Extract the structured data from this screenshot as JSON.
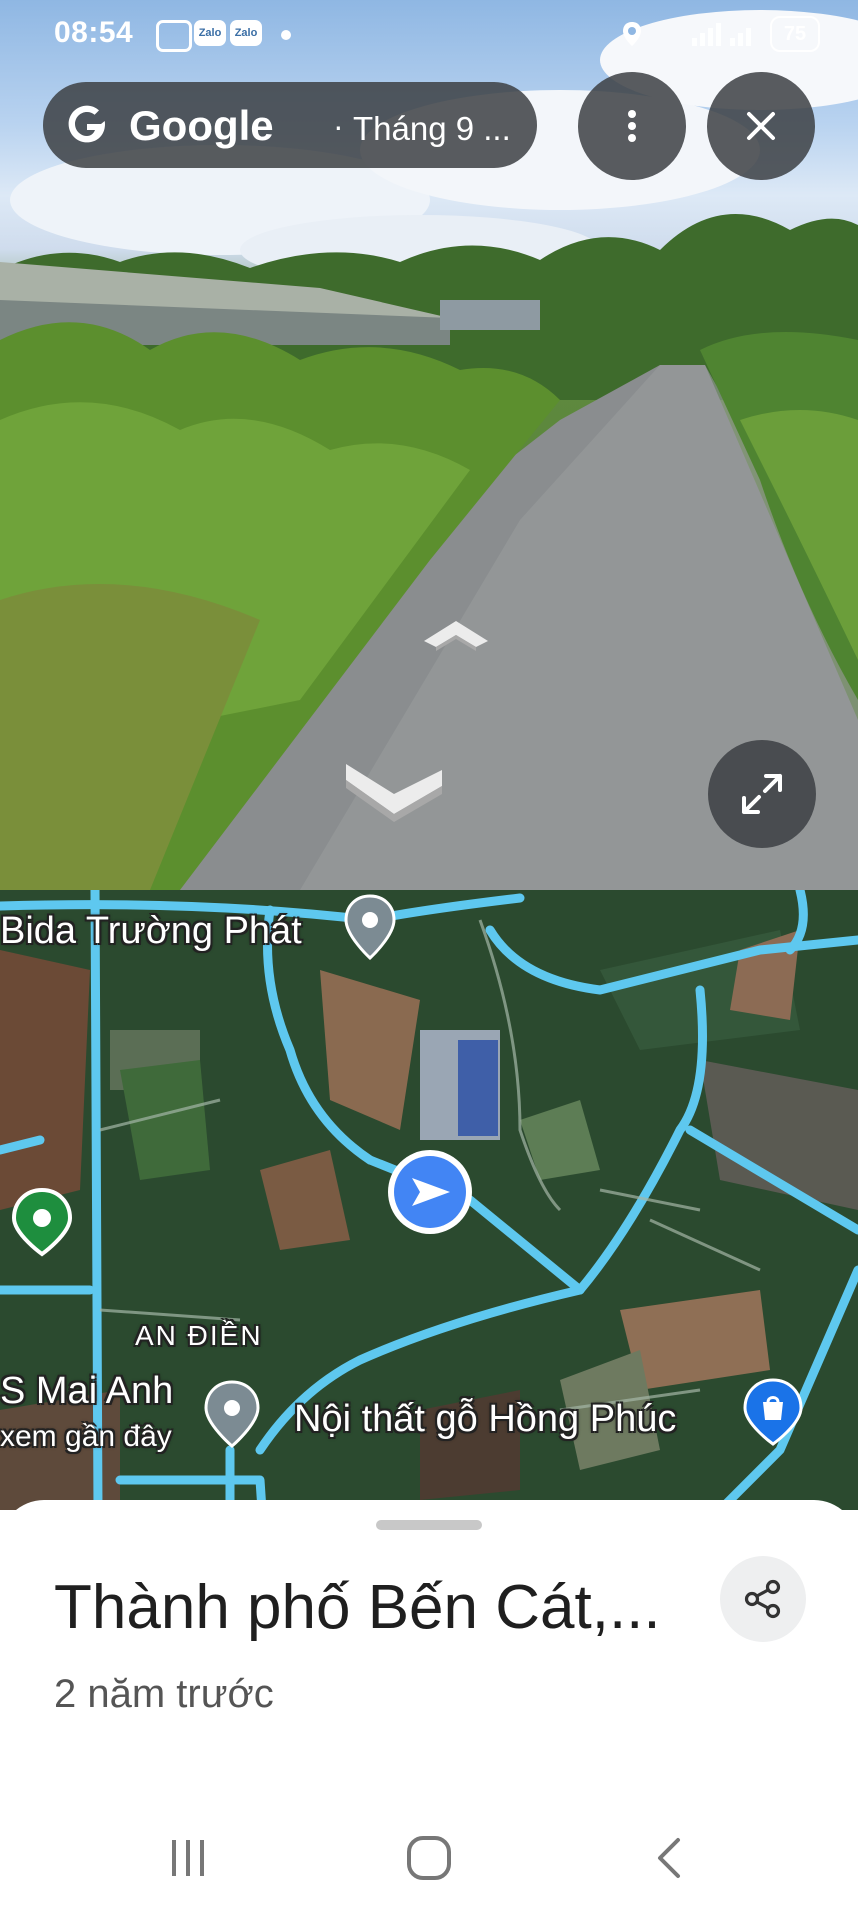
{
  "status_bar": {
    "time": "08:54",
    "icons": [
      "screenshot-icon",
      "zalo-icon",
      "zalo-icon",
      "notification-dot"
    ],
    "zalo_label": "Zalo",
    "battery": "75"
  },
  "street_view": {
    "search_pill": {
      "brand": "Google",
      "separator": "·",
      "date": "Tháng 9 ..."
    },
    "icons": {
      "more": "more-vert-icon",
      "close": "close-icon",
      "fullscreen": "expand-icon"
    }
  },
  "map": {
    "labels": {
      "bida": "Bida Trường Phát",
      "an_dien": "AN ĐIỀN",
      "mai_anh": "S Mai Anh",
      "mai_anh_sub": "xem gần đây",
      "noi_that": "Nội thất gỗ Hồng Phúc"
    },
    "colors": {
      "road": "#5ec8ef",
      "marker_grey": "#7c8b93",
      "marker_green": "#1e8e3e",
      "marker_blue": "#4285f4",
      "marker_shop": "#1a73e8"
    }
  },
  "sheet": {
    "title": "Thành phố Bến Cát,...",
    "subtitle": "2 năm trước",
    "share_icon": "share-icon"
  },
  "system_nav": [
    "recent-apps-icon",
    "home-icon",
    "back-icon"
  ]
}
